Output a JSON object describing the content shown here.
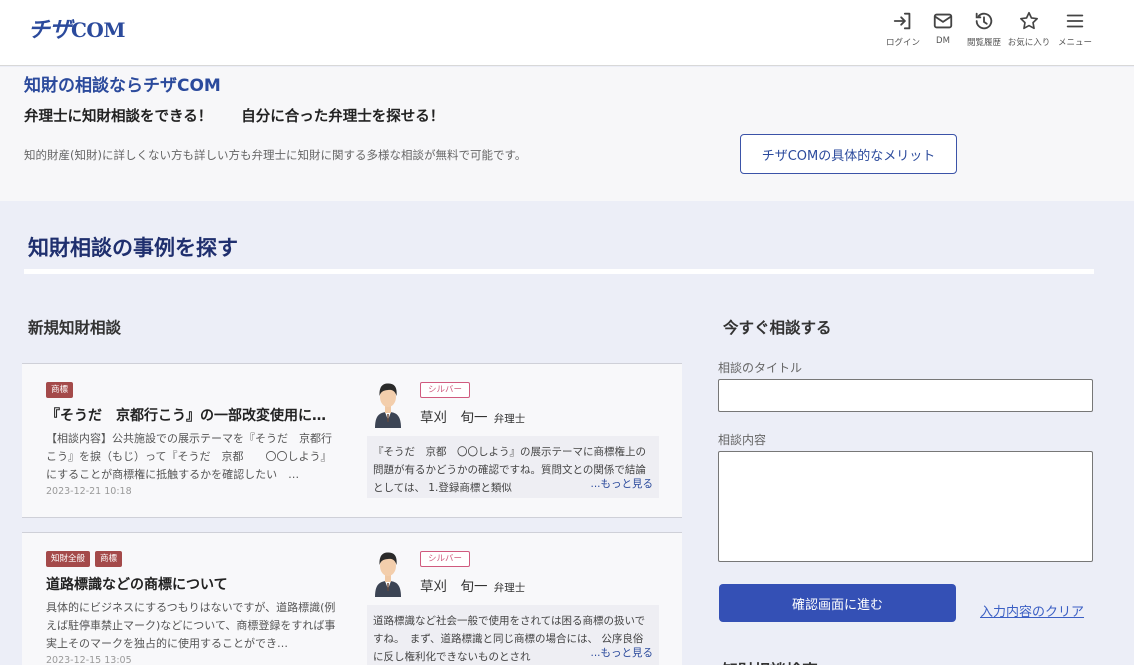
{
  "header": {
    "logo_jp": "チザ",
    "logo_en": "COM",
    "nav": [
      {
        "label": "ログイン",
        "icon": "login-icon"
      },
      {
        "label": "DM",
        "icon": "mail-icon"
      },
      {
        "label": "閲覧履歴",
        "icon": "history-icon"
      },
      {
        "label": "お気に入り",
        "icon": "star-icon"
      },
      {
        "label": "メニュー",
        "icon": "hamburger-menu-icon"
      }
    ]
  },
  "intro": {
    "title": "知財の相談ならチザCOM",
    "subtitle": "弁理士に知財相談をできる！　　自分に合った弁理士を探せる！",
    "description": "知的財産(知財)に詳しくない方も詳しい方も弁理士に知財に関する多様な相談が無料で可能です。",
    "merit_button": "チザCOMの具体的なメリット"
  },
  "section": {
    "title": "知財相談の事例を探す",
    "new_title": "新規知財相談",
    "consult_title": "今すぐ相談する"
  },
  "cards": [
    {
      "tags": [
        "商標"
      ],
      "title": "『そうだ　京都行こう』の一部改変使用に…",
      "body": "【相談内容】公共施設での展示テーマを『そうだ　京都行こう』を捩（もじ）って『そうだ　京都　　〇〇しよう』にすることが商標権に抵触するかを確認したい　…",
      "date": "2023-12-21 10:18",
      "rank": "シルバー",
      "lawyer": "草刈　旬一",
      "role": "弁理士",
      "quote": "『そうだ　京都　〇〇しよう』の展示テーマに商標権上の問題が有るかどうかの確認ですね。質問文との関係で結論としては、 1.登録商標と類似",
      "more": "...もっと見る"
    },
    {
      "tags": [
        "知財全般",
        "商標"
      ],
      "title": "道路標識などの商標について",
      "body": "具体的にビジネスにするつもりはないですが、道路標識(例えば駐停車禁止マーク)などについて、商標登録をすれば事実上そのマークを独占的に使用することができ…",
      "date": "2023-12-15 13:05",
      "rank": "シルバー",
      "lawyer": "草刈　旬一",
      "role": "弁理士",
      "quote": "道路標識など社会一般で使用をされては困る商標の扱いですね。　まず、道路標識と同じ商標の場合には、 公序良俗に反し権利化できないものとされ",
      "more": "...もっと見る"
    }
  ],
  "form": {
    "title_label": "相談のタイトル",
    "title_value": "",
    "content_label": "相談内容",
    "content_value": "",
    "submit": "確認画面に進む",
    "clear": "入力内容のクリア"
  },
  "bottom_heading": "知財相談検索"
}
